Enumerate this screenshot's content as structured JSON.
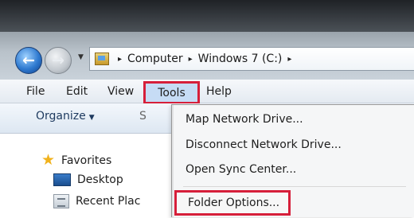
{
  "breadcrumb": {
    "items": [
      "Computer",
      "Windows 7 (C:)"
    ],
    "separator": "▸"
  },
  "menubar": {
    "file": "File",
    "edit": "Edit",
    "view": "View",
    "tools": "Tools",
    "help": "Help"
  },
  "toolbar": {
    "organize": "Organize",
    "cut_text": "S"
  },
  "navpane": {
    "favorites": "Favorites",
    "desktop": "Desktop",
    "recent": "Recent Plac"
  },
  "tools_menu": {
    "items": [
      "Map Network Drive...",
      "Disconnect Network Drive...",
      "Open Sync Center...",
      "Folder Options..."
    ]
  },
  "colors": {
    "highlight_border": "#d61f3a",
    "menu_selected_bg": "#c6dcf5"
  }
}
